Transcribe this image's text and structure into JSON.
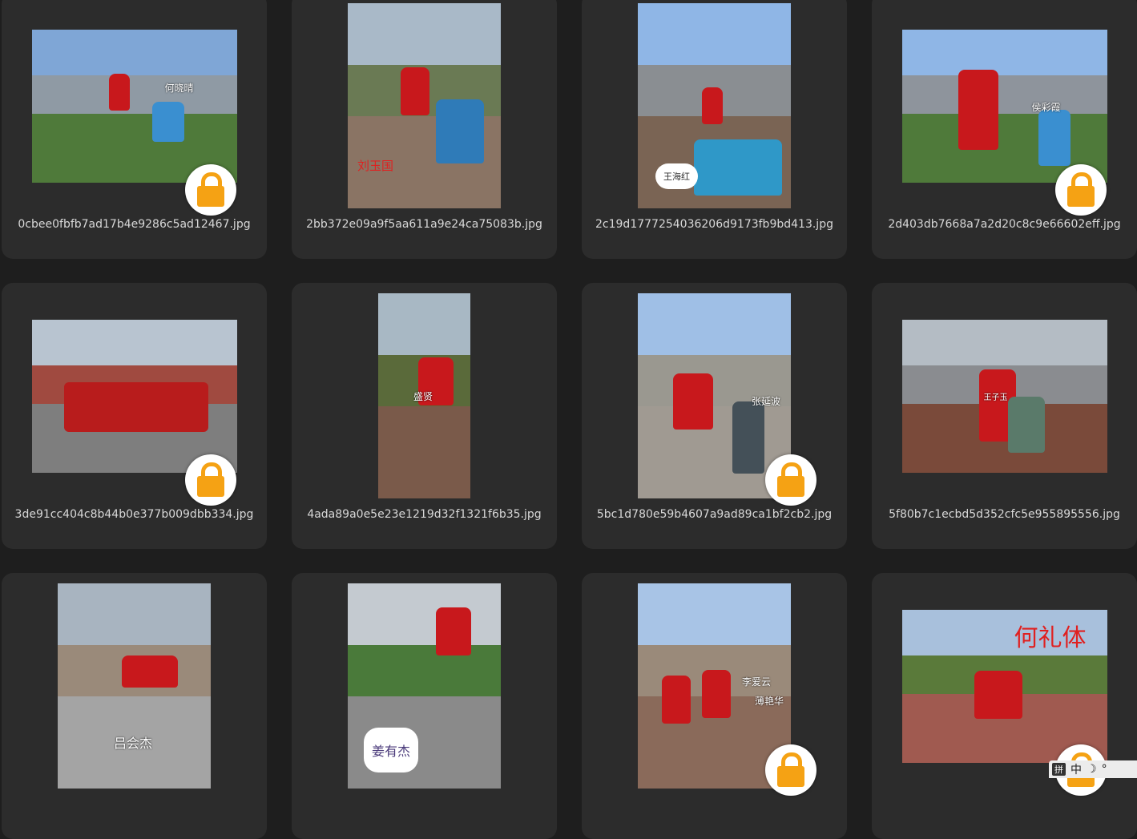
{
  "gallery": {
    "items": [
      {
        "filename": "0cbee0fbfb7ad17b4e9286c5ad12467.jpg",
        "caption": "何晓晴",
        "locked": true
      },
      {
        "filename": "2bb372e09a9f5aa611a9e24ca75083b.jpg",
        "caption": "刘玉国",
        "locked": false
      },
      {
        "filename": "2c19d1777254036206d9173fb9bd413.jpg",
        "caption": "王海红",
        "locked": false
      },
      {
        "filename": "2d403db7668a7a2d20c8c9e66602eff.jpg",
        "caption": "侯彩霞",
        "locked": true
      },
      {
        "filename": "3de91cc404c8b44b0e377b009dbb334.jpg",
        "caption": "",
        "locked": true
      },
      {
        "filename": "4ada89a0e5e23e1219d32f1321f6b35.jpg",
        "caption": "盛贤",
        "locked": false
      },
      {
        "filename": "5bc1d780e59b4607a9ad89ca1bf2cb2.jpg",
        "caption": "张延波",
        "locked": true
      },
      {
        "filename": "5f80b7c1ecbd5d352cfc5e955895556.jpg",
        "caption": "王子玉",
        "locked": false
      },
      {
        "filename": "",
        "caption": "吕会杰",
        "locked": false
      },
      {
        "filename": "",
        "caption": "姜有杰",
        "locked": false
      },
      {
        "filename": "",
        "caption": "李爱云",
        "caption2": "薄艳华",
        "locked": true
      },
      {
        "filename": "",
        "caption": "何礼体",
        "locked": true
      }
    ]
  },
  "tray": {
    "ime_label": "拼",
    "lang": "中",
    "moon": "☽",
    "dot": "°"
  },
  "colors": {
    "lock": "#f5a214",
    "card": "#2c2c2c",
    "background": "#1e1e1e"
  },
  "icons": {
    "lock": "lock-icon"
  }
}
